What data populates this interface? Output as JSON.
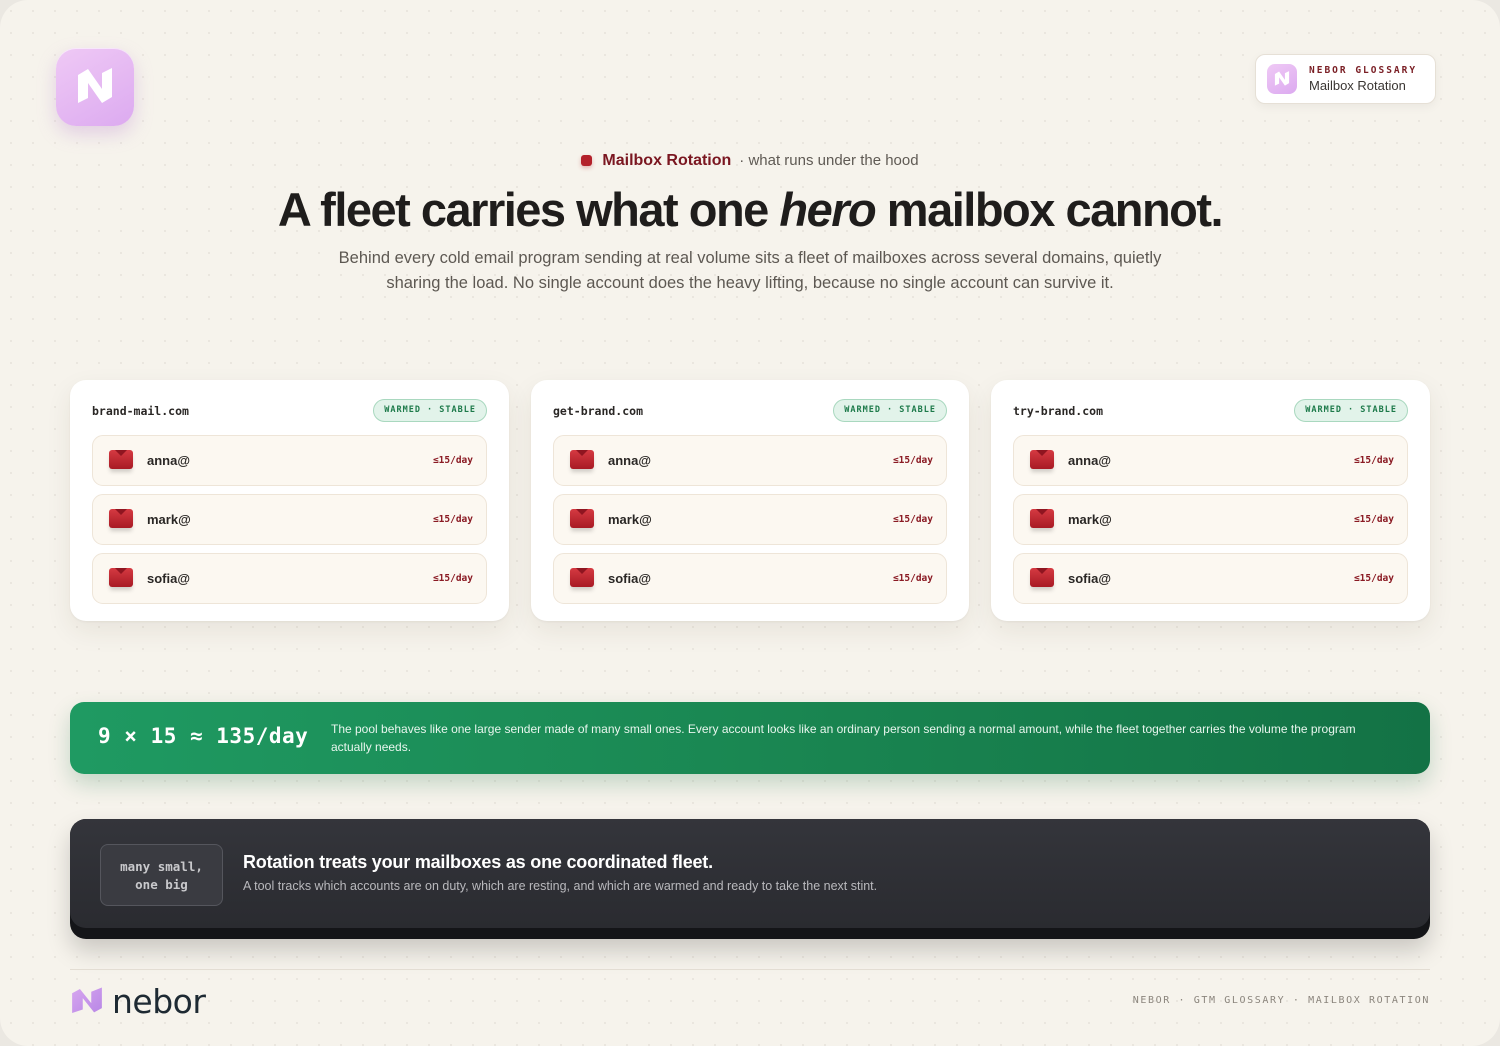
{
  "brand": {
    "wordmark": "nebor",
    "logo_icon": "nebor-n-logo-icon",
    "colors": {
      "lilac": "#dcaaf0",
      "maroon": "#7a1620",
      "green": "#1a8752",
      "dark": "#2a2b30"
    }
  },
  "glossary_badge": {
    "kicker": "NEBOR GLOSSARY",
    "name": "Mailbox Rotation"
  },
  "header": {
    "topic": "Mailbox Rotation",
    "eyebrow_suffix": "· what runs under the hood",
    "headline_before": "A fleet carries what one ",
    "headline_em": "hero",
    "headline_after": " mailbox cannot.",
    "lede": "Behind every cold email program sending at real volume sits a fleet of mailboxes across several domains, quietly sharing the load. No single account does the heavy lifting, because no single account can survive it."
  },
  "domains": [
    {
      "name": "brand-mail.com",
      "status": "WARMED · STABLE",
      "mailboxes": [
        {
          "user": "anna@",
          "cap": "≤15/day"
        },
        {
          "user": "mark@",
          "cap": "≤15/day"
        },
        {
          "user": "sofia@",
          "cap": "≤15/day"
        }
      ]
    },
    {
      "name": "get-brand.com",
      "status": "WARMED · STABLE",
      "mailboxes": [
        {
          "user": "anna@",
          "cap": "≤15/day"
        },
        {
          "user": "mark@",
          "cap": "≤15/day"
        },
        {
          "user": "sofia@",
          "cap": "≤15/day"
        }
      ]
    },
    {
      "name": "try-brand.com",
      "status": "WARMED · STABLE",
      "mailboxes": [
        {
          "user": "anna@",
          "cap": "≤15/day"
        },
        {
          "user": "mark@",
          "cap": "≤15/day"
        },
        {
          "user": "sofia@",
          "cap": "≤15/day"
        }
      ]
    }
  ],
  "formula": {
    "equation": "9 × 15 ≈ 135/day",
    "text": "The pool behaves like one large sender made of many small ones. Every account looks like an ordinary person sending a normal amount, while the fleet together carries the volume the program actually needs."
  },
  "callout": {
    "chip_line1": "many small,",
    "chip_line2": "one big",
    "title": "Rotation treats your mailboxes as one coordinated fleet.",
    "desc": "A tool tracks which accounts are on duty, which are resting, and which are warmed and ready to take the next stint."
  },
  "footer": {
    "meta": "NEBOR · GTM GLOSSARY · MAILBOX ROTATION"
  }
}
